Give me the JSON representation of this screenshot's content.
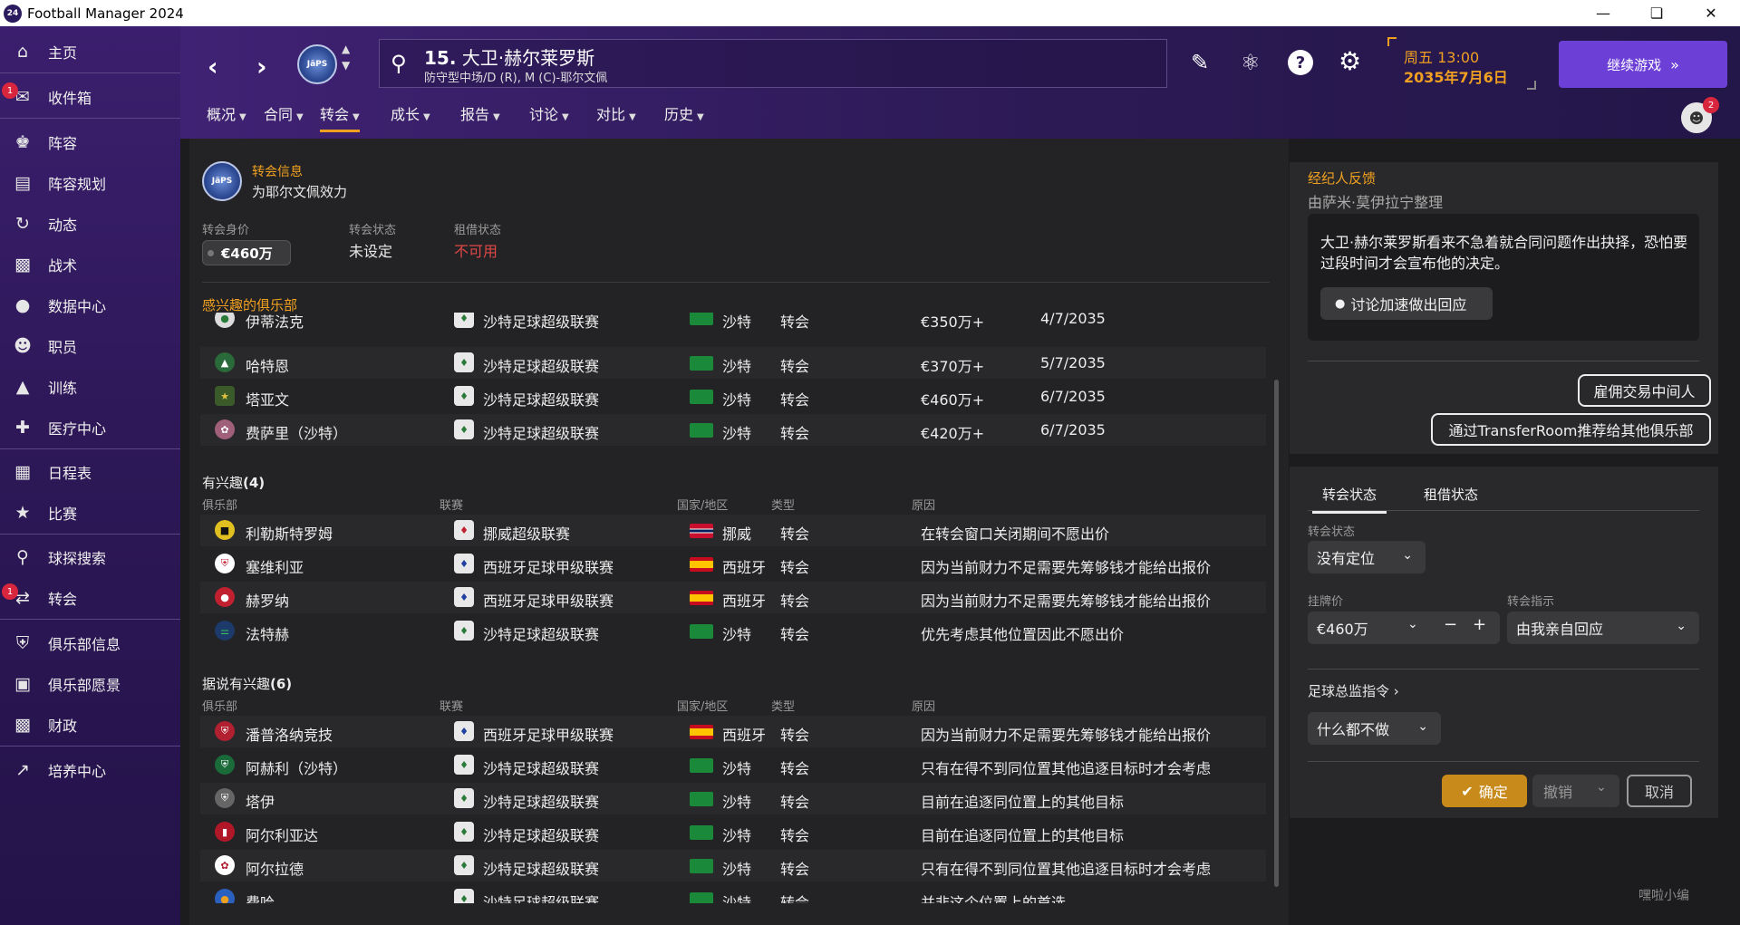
{
  "window": {
    "title": "Football Manager 2024",
    "icon_text": "24",
    "controls": [
      "minimize-icon",
      "restore-icon",
      "close-icon"
    ]
  },
  "sidebar": {
    "items": [
      {
        "label": "主页",
        "icon": "home-icon"
      },
      {
        "label": "收件箱",
        "icon": "inbox-icon",
        "badge": "1"
      },
      {
        "label": "阵容",
        "icon": "shirt-icon"
      },
      {
        "label": "阵容规划",
        "icon": "clipboard-icon"
      },
      {
        "label": "动态",
        "icon": "dynamics-icon"
      },
      {
        "label": "战术",
        "icon": "tactics-board-icon"
      },
      {
        "label": "数据中心",
        "icon": "data-hub-icon"
      },
      {
        "label": "职员",
        "icon": "staff-icon"
      },
      {
        "label": "训练",
        "icon": "training-cone-icon"
      },
      {
        "label": "医疗中心",
        "icon": "medical-bag-icon"
      },
      {
        "label": "日程表",
        "icon": "calendar-icon"
      },
      {
        "label": "比赛",
        "icon": "trophy-icon"
      },
      {
        "label": "球探搜索",
        "icon": "search-icon"
      },
      {
        "label": "转会",
        "icon": "transfer-arrows-icon",
        "badge": "1"
      },
      {
        "label": "俱乐部信息",
        "icon": "club-shield-icon"
      },
      {
        "label": "俱乐部愿景",
        "icon": "briefcase-icon"
      },
      {
        "label": "财政",
        "icon": "finance-icon"
      },
      {
        "label": "培养中心",
        "icon": "development-icon"
      }
    ]
  },
  "header": {
    "player_number": "15.",
    "player_name": "大卫·赫尔莱罗斯",
    "player_position": "防守型中场/D (R), M (C)-耶尔文佩",
    "crest_text": "JäPS",
    "day_time": "周五 13:00",
    "date": "2035年7月6日",
    "continue_label": "继续游戏",
    "social_badge": "2",
    "tabs": [
      {
        "label": "概况",
        "active": false
      },
      {
        "label": "合同",
        "active": false
      },
      {
        "label": "转会",
        "active": true
      },
      {
        "label": "成长",
        "active": false
      },
      {
        "label": "报告",
        "active": false
      },
      {
        "label": "讨论",
        "active": false
      },
      {
        "label": "对比",
        "active": false
      },
      {
        "label": "历史",
        "active": false
      }
    ]
  },
  "transfer_info": {
    "title": "转会信息",
    "subtitle": "为耶尔文佩效力",
    "value_label": "转会身价",
    "value": "€460万",
    "status_label": "转会状态",
    "status": "未设定",
    "loan_label": "租借状态",
    "loan": "不可用",
    "loan_color": "#e04848"
  },
  "interested_clubs": {
    "title": "感兴趣的俱乐部",
    "offers": [
      {
        "club": "伊蒂法克",
        "league": "沙特足球超级联赛",
        "country": "沙特",
        "type": "转会",
        "value": "€350万+",
        "date": "4/7/2035"
      },
      {
        "club": "哈特恩",
        "league": "沙特足球超级联赛",
        "country": "沙特",
        "type": "转会",
        "value": "€370万+",
        "date": "5/7/2035"
      },
      {
        "club": "塔亚文",
        "league": "沙特足球超级联赛",
        "country": "沙特",
        "type": "转会",
        "value": "€460万+",
        "date": "6/7/2035"
      },
      {
        "club": "费萨里（沙特）",
        "league": "沙特足球超级联赛",
        "country": "沙特",
        "type": "转会",
        "value": "€420万+",
        "date": "6/7/2035"
      }
    ],
    "columns": {
      "club": "俱乐部",
      "league": "联赛",
      "country": "国家/地区",
      "type": "类型",
      "reason": "原因"
    },
    "interested_title": "有兴趣",
    "interested_count": "(4)",
    "interested": [
      {
        "club": "利勒斯特罗姆",
        "league": "挪威超级联赛",
        "country": "挪威",
        "type": "转会",
        "reason": "在转会窗口关闭期间不愿出价"
      },
      {
        "club": "塞维利亚",
        "league": "西班牙足球甲级联赛",
        "country": "西班牙",
        "type": "转会",
        "reason": "因为当前财力不足需要先筹够钱才能给出报价"
      },
      {
        "club": "赫罗纳",
        "league": "西班牙足球甲级联赛",
        "country": "西班牙",
        "type": "转会",
        "reason": "因为当前财力不足需要先筹够钱才能给出报价"
      },
      {
        "club": "法特赫",
        "league": "沙特足球超级联赛",
        "country": "沙特",
        "type": "转会",
        "reason": "优先考虑其他位置因此不愿出价"
      }
    ],
    "rumoured_title": "据说有兴趣",
    "rumoured_count": "(6)",
    "rumoured": [
      {
        "club": "潘普洛纳竞技",
        "league": "西班牙足球甲级联赛",
        "country": "西班牙",
        "type": "转会",
        "reason": "因为当前财力不足需要先筹够钱才能给出报价"
      },
      {
        "club": "阿赫利（沙特）",
        "league": "沙特足球超级联赛",
        "country": "沙特",
        "type": "转会",
        "reason": "只有在得不到同位置其他追逐目标时才会考虑"
      },
      {
        "club": "塔伊",
        "league": "沙特足球超级联赛",
        "country": "沙特",
        "type": "转会",
        "reason": "目前在追逐同位置上的其他目标"
      },
      {
        "club": "阿尔利亚达",
        "league": "沙特足球超级联赛",
        "country": "沙特",
        "type": "转会",
        "reason": "目前在追逐同位置上的其他目标"
      },
      {
        "club": "阿尔拉德",
        "league": "沙特足球超级联赛",
        "country": "沙特",
        "type": "转会",
        "reason": "只有在得不到同位置其他追逐目标时才会考虑"
      },
      {
        "club": "费哈",
        "league": "沙特足球超级联赛",
        "country": "沙特",
        "type": "转会",
        "reason": "并非这个位置上的首选"
      }
    ]
  },
  "agent": {
    "title": "经纪人反馈",
    "by": "由萨米·莫伊拉宁整理",
    "message": "大卫·赫尔莱罗斯看来不急着就合同问题作出抉择，恐怕要过段时间才会宣布他的决定。",
    "discuss_label": "讨论加速做出回应",
    "hire_label": "雇佣交易中间人",
    "recommend_label": "通过TransferRoom推荐给其他俱乐部"
  },
  "status_panel": {
    "tab_transfer": "转会状态",
    "tab_loan": "租借状态",
    "status_label": "转会状态",
    "status_value": "没有定位",
    "asking_label": "挂牌价",
    "asking_value": "€460万",
    "instruction_label": "转会指示",
    "instruction_value": "由我亲自回应",
    "director_label": "足球总监指令",
    "director_value": "什么都不做",
    "confirm_label": "确定",
    "undo_label": "撤销",
    "cancel_label": "取消"
  },
  "watermark": "嘿啦小编"
}
